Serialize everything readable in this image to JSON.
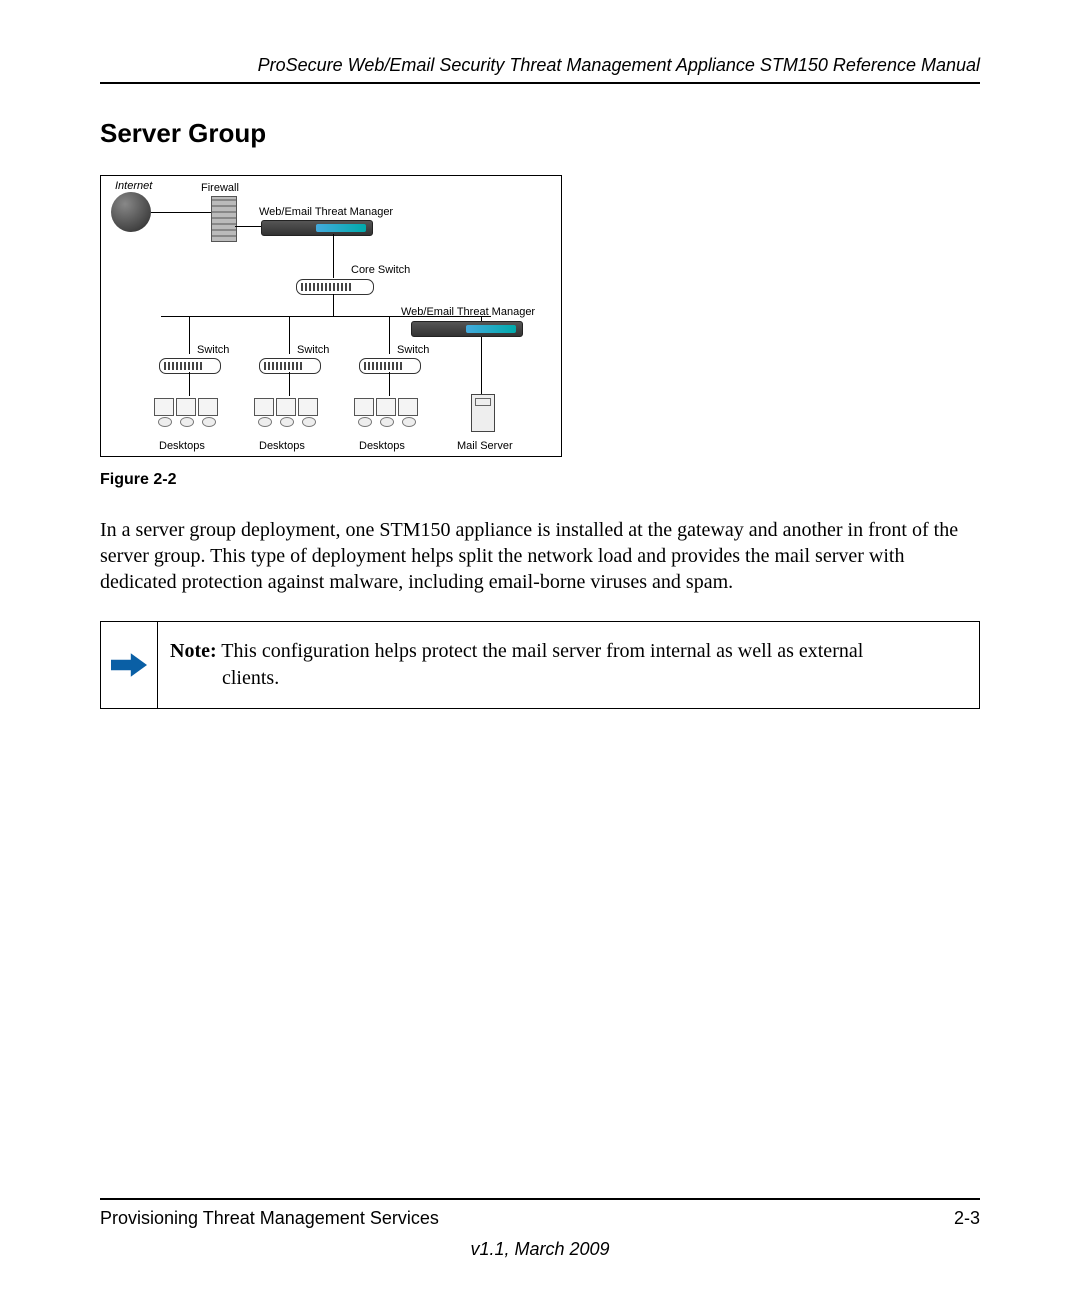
{
  "header": {
    "running_title": "ProSecure Web/Email Security Threat Management Appliance STM150 Reference Manual"
  },
  "section": {
    "title": "Server Group"
  },
  "diagram": {
    "internet_label": "Internet",
    "firewall_label": "Firewall",
    "threat_manager_label_top": "Web/Email Threat Manager",
    "core_switch_label": "Core Switch",
    "threat_manager_label_right": "Web/Email Threat Manager",
    "switch_label_1": "Switch",
    "switch_label_2": "Switch",
    "switch_label_3": "Switch",
    "desktops_label_1": "Desktops",
    "desktops_label_2": "Desktops",
    "desktops_label_3": "Desktops",
    "mail_server_label": "Mail Server"
  },
  "figure": {
    "caption": "Figure 2-2"
  },
  "body": {
    "paragraph": "In a server group deployment, one STM150 appliance is installed at the gateway and another in front of the server group. This type of deployment helps split the network load and provides the mail server with dedicated protection against malware, including email-borne viruses and spam."
  },
  "note": {
    "label": "Note:",
    "text_line1": " This configuration helps protect the mail server from internal as well as external",
    "text_line2": "clients."
  },
  "footer": {
    "section_name": "Provisioning Threat Management Services",
    "page_number": "2-3",
    "version": "v1.1, March 2009"
  }
}
